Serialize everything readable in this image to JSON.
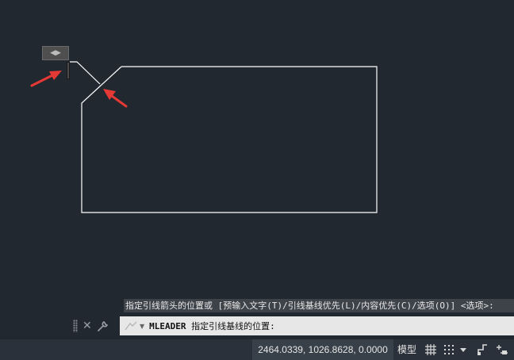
{
  "window": {
    "background_color": "#212830"
  },
  "canvas": {
    "leader_control_glyph": "◀▶",
    "line_color": "#ffffff",
    "annotation_arrow_color": "#e53935"
  },
  "command_line": {
    "history_text": "指定引线箭头的位置或 [预输入文字(T)/引线基线优先(L)/内容优先(C)/选项(O)] <选项>:",
    "command_name": "MLEADER",
    "prompt_text": "指定引线基线的位置:",
    "close_icon": "close-icon",
    "customize_icon": "wrench-icon",
    "prompt_icon": "command-prompt-icon"
  },
  "status_bar": {
    "coordinates": "2464.0339, 1026.8628, 0.0000",
    "model_label": "模型",
    "icons": [
      "grid-icon",
      "snap-icon",
      "dropdown-icon",
      "ortho-icon",
      "polar-icon"
    ]
  }
}
